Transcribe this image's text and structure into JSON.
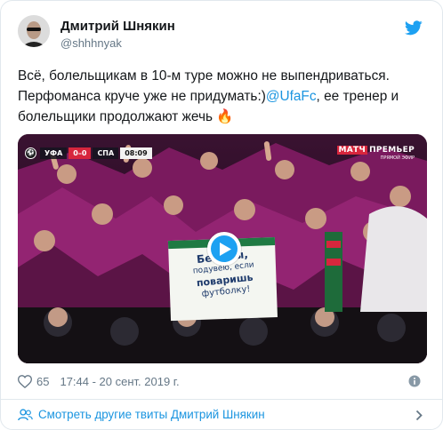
{
  "author": {
    "name": "Дмитрий Шнякин",
    "handle": "@shhhnyak"
  },
  "tweet": {
    "line1": "Всё, болельщикам в 10-м туре можно не выпендриваться.",
    "line2_before": "Перфоманса круче уже не придумать:)",
    "mention": "@UfaFc",
    "line2_after": ", ее тренер и",
    "line3": "болельщики продолжают жечь",
    "emoji": "🔥"
  },
  "media": {
    "scorebug": {
      "team_home": "УФА",
      "score": "0–0",
      "team_away": "СПА",
      "clock": "08:09"
    },
    "channel": {
      "name_accent": "МАТЧ",
      "name_rest": "ПРЕМЬЕР",
      "subtitle": "ПРЯМОЙ ЭФИР"
    },
    "sign_lines": [
      "Белены,",
      "подувею, если",
      "поваришь",
      "футболку!"
    ]
  },
  "meta": {
    "likes": "65",
    "timestamp": "17:44 - 20 сент. 2019 г."
  },
  "footer": {
    "more_tweets": "Смотреть другие твиты Дмитрий Шнякин"
  },
  "colors": {
    "link": "#1b95e0",
    "twitter_blue": "#1da1f2",
    "muted": "#657786",
    "border": "#e1e8ed",
    "scarf_magenta": "#8a1f6b"
  },
  "icons": {
    "twitter": "twitter-bird-icon",
    "play": "play-icon",
    "like": "heart-icon",
    "info": "info-icon",
    "people": "people-icon",
    "chevron": "chevron-right-icon"
  }
}
